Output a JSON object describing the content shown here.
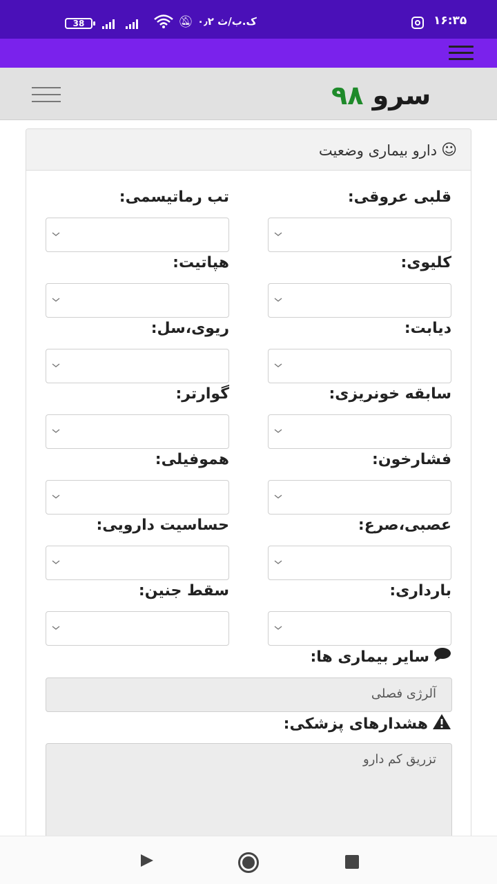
{
  "status_bar": {
    "time": "۱۶:۳۵",
    "network_speed": "۰٫۲ ک.ب/ث",
    "battery": "38"
  },
  "header": {
    "logo_text": "سرو",
    "logo_number": "۹۸"
  },
  "card": {
    "title": "دارو بیماری وضعیت",
    "icon": "smile-icon",
    "fields_right": [
      {
        "label": "قلبی عروقی:",
        "value": ""
      },
      {
        "label": "کلیوی:",
        "value": ""
      },
      {
        "label": "دیابت:",
        "value": ""
      },
      {
        "label": "سابقه خونریزی:",
        "value": ""
      },
      {
        "label": "فشارخون:",
        "value": ""
      },
      {
        "label": "عصبی،صرع:",
        "value": ""
      },
      {
        "label": "بارداری:",
        "value": ""
      }
    ],
    "fields_left": [
      {
        "label": "تب رماتیسمی:",
        "value": ""
      },
      {
        "label": "هپاتیت:",
        "value": ""
      },
      {
        "label": "ریوی،سل:",
        "value": ""
      },
      {
        "label": "گوارتر:",
        "value": ""
      },
      {
        "label": "هموفیلی:",
        "value": ""
      },
      {
        "label": "حساسیت دارویی:",
        "value": ""
      },
      {
        "label": "سقط جنین:",
        "value": ""
      }
    ],
    "other_diseases": {
      "label": "سایر بیماری ها:",
      "icon": "comment-icon",
      "value": "آلرژی فصلی"
    },
    "medical_warnings": {
      "label": "هشدارهای پزشکی:",
      "icon": "warning-icon",
      "value": "تزریق کم دارو"
    }
  },
  "colors": {
    "status_bar": "#4a10b8",
    "app_bar": "#7a22ec",
    "logo_number": "#1e8a2a",
    "header_bg": "#e1e1e1"
  }
}
